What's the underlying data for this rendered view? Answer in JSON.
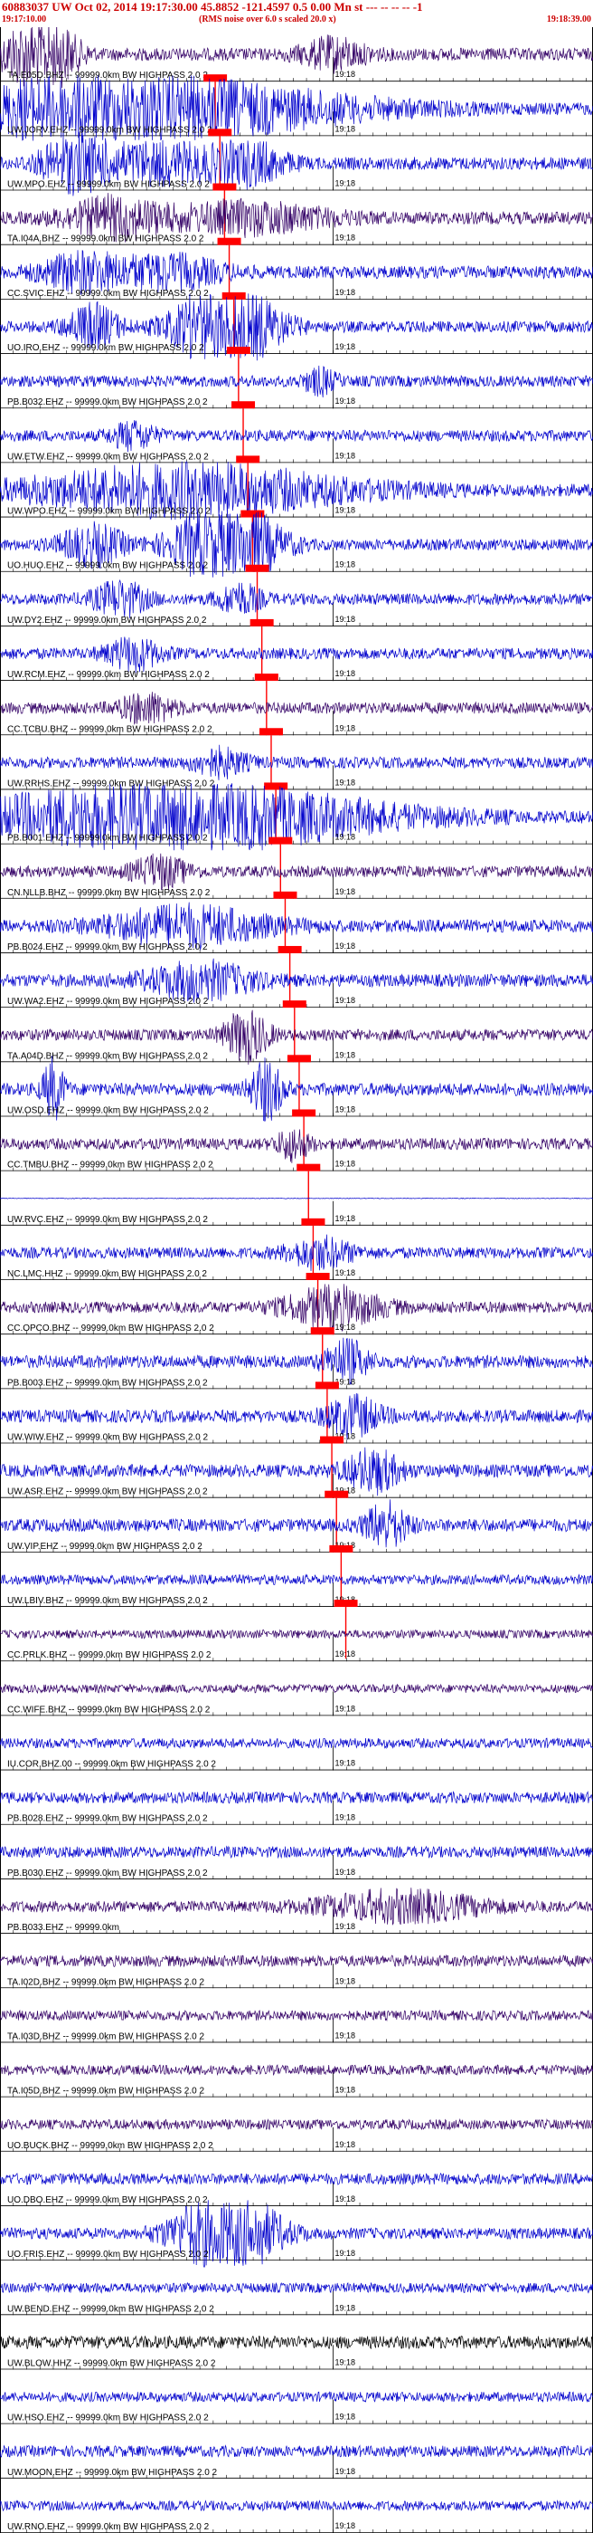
{
  "header": {
    "title": "60883037 UW Oct 02, 2014 19:17:30.00   45.8852 -121.4597  0.5 0.00 Mn st --- -- -- --  -1",
    "start_time": "19:17:10.00",
    "note": "(RMS noise over 6.0 s scaled 20.0 x)",
    "end_time": "19:18:39.00"
  },
  "chart_data": {
    "type": "seismogram",
    "tick_label": "19:18",
    "time_axis": {
      "start": "19:17:10.00",
      "end": "19:18:39.00",
      "origin": "19:17:30.00"
    },
    "colors": {
      "trace_blue": "#0000cc",
      "trace_purple": "#330066",
      "trace_black": "#000000",
      "pick": "#ff0000",
      "title": "#cc0000"
    },
    "traces": [
      {
        "label": "TA.E05D.BHZ -- 99999.0km BW  HIGHPASS  2.0  2",
        "pick_s": 32.3,
        "color": "purple",
        "amp": 0.9,
        "events": [
          [
            6,
            12,
            3.5
          ],
          [
            50,
            12,
            1.0
          ]
        ]
      },
      {
        "label": "UW.JORV.EHZ -- 99999.0km BW  HIGHPASS  2.0  2",
        "pick_s": 33.0,
        "color": "blue",
        "amp": 0.9,
        "events": [
          [
            9,
            22,
            1.2
          ],
          [
            24,
            70,
            2.0
          ]
        ]
      },
      {
        "label": "UW.MPO.EHZ -- 99999.0km BW  HIGHPASS  2.0  2",
        "pick_s": 33.7,
        "color": "blue",
        "amp": 0.9,
        "events": [
          [
            11,
            12,
            1.5
          ],
          [
            24,
            30,
            1.3
          ],
          [
            38,
            12,
            1.1
          ]
        ]
      },
      {
        "label": "TA.I04A.BHZ -- 99999.0km BW  HIGHPASS  2.0  2",
        "pick_s": 34.4,
        "color": "purple",
        "amp": 0.9,
        "events": [
          [
            17,
            18,
            1.3
          ],
          [
            37,
            30,
            1.0
          ]
        ]
      },
      {
        "label": "CC.SVIC.EHZ -- 99999.0km BW  HIGHPASS  2.0  2",
        "pick_s": 35.1,
        "color": "blue",
        "amp": 0.9,
        "events": [
          [
            12,
            15,
            1.2
          ],
          [
            25,
            20,
            1.1
          ]
        ]
      },
      {
        "label": "UO.IRO.EHZ -- 99999.0km BW  HIGHPASS  2.0  2",
        "pick_s": 35.8,
        "color": "blue",
        "amp": 0.8,
        "events": [
          [
            14,
            10,
            1.6
          ],
          [
            34,
            18,
            4.0
          ]
        ]
      },
      {
        "label": "PB.B032.EHZ -- 99999.0km BW  HIGHPASS  2.0  2",
        "pick_s": 36.5,
        "color": "blue",
        "amp": 0.8,
        "events": [
          [
            48,
            6,
            0.9
          ]
        ]
      },
      {
        "label": "UW.ETW.EHZ -- 99999.0km BW  HIGHPASS  2.0  2",
        "pick_s": 37.2,
        "color": "blue",
        "amp": 0.8,
        "events": [
          [
            20,
            8,
            1.0
          ]
        ]
      },
      {
        "label": "UW.WPO.EHZ -- 99999.0km BW  HIGHPASS  2.0  2",
        "pick_s": 37.9,
        "color": "blue",
        "amp": 0.9,
        "events": [
          [
            28,
            60,
            1.7
          ]
        ]
      },
      {
        "label": "UO.HUO.EHZ -- 99999.0km BW  HIGHPASS  2.0  2",
        "pick_s": 38.6,
        "color": "blue",
        "amp": 0.8,
        "events": [
          [
            14,
            12,
            1.5
          ],
          [
            34,
            18,
            4.0
          ]
        ]
      },
      {
        "label": "UW.DY2.EHZ -- 99999.0km BW  HIGHPASS  2.0  2",
        "pick_s": 39.3,
        "color": "blue",
        "amp": 0.8,
        "events": [
          [
            18,
            10,
            1.3
          ],
          [
            36,
            8,
            1.1
          ]
        ]
      },
      {
        "label": "UW.RCM.EHZ -- 99999.0km BW  HIGHPASS  2.0  2",
        "pick_s": 40.0,
        "color": "blue",
        "amp": 0.8,
        "events": [
          [
            20,
            10,
            1.2
          ]
        ]
      },
      {
        "label": "CC.TCBU.BHZ -- 99999.0km BW  HIGHPASS  2.0  2",
        "pick_s": 40.7,
        "color": "purple",
        "amp": 0.8,
        "events": [
          [
            22,
            10,
            1.1
          ]
        ]
      },
      {
        "label": "UW.RRHS.EHZ -- 99999.0km BW  HIGHPASS  2.0  2",
        "pick_s": 41.4,
        "color": "blue",
        "amp": 0.8,
        "events": [
          [
            33,
            10,
            1.0
          ]
        ]
      },
      {
        "label": "PB.B001.EHZ -- 99999.0km BW  HIGHPASS  2.0  2",
        "pick_s": 42.1,
        "color": "blue",
        "amp": 0.9,
        "events": [
          [
            26,
            74,
            2.4
          ]
        ]
      },
      {
        "label": "CN.NLLB.BHZ -- 99999.0km BW  HIGHPASS  2.0  2",
        "pick_s": 42.8,
        "color": "purple",
        "amp": 0.8,
        "events": [
          [
            24,
            10,
            1.2
          ]
        ]
      },
      {
        "label": "PB.B024.EHZ -- 99999.0km BW  HIGHPASS  2.0  2",
        "pick_s": 43.5,
        "color": "blue",
        "amp": 0.9,
        "events": [
          [
            28,
            30,
            1.3
          ]
        ]
      },
      {
        "label": "UW.WA2.EHZ -- 99999.0km BW  HIGHPASS  2.0  2",
        "pick_s": 44.2,
        "color": "blue",
        "amp": 0.9,
        "events": [
          [
            30,
            20,
            1.2
          ]
        ]
      },
      {
        "label": "TA.A04D.BHZ -- 99999.0km BW  HIGHPASS  2.0  2",
        "pick_s": 44.9,
        "color": "purple",
        "amp": 0.8,
        "events": [
          [
            37,
            8,
            2.0
          ]
        ]
      },
      {
        "label": "UW.OSD.EHZ -- 99999.0km BW  HIGHPASS  2.0  2",
        "pick_s": 45.6,
        "color": "blue",
        "amp": 0.9,
        "events": [
          [
            8,
            4,
            2.0
          ],
          [
            40,
            6,
            2.0
          ]
        ]
      },
      {
        "label": "CC.TMBU.BHZ -- 99999.0km BW  HIGHPASS  2.0  2",
        "pick_s": 46.3,
        "color": "purple",
        "amp": 0.8,
        "events": [
          [
            44,
            6,
            1.2
          ]
        ]
      },
      {
        "label": "UW.RVC.EHZ -- 99999.0km BW  HIGHPASS  2.0  2",
        "pick_s": 47.0,
        "color": "blue",
        "amp": 0.05,
        "events": []
      },
      {
        "label": "NC.LMC.HHZ -- 99999.0km BW  HIGHPASS  2.0  2",
        "pick_s": 47.7,
        "color": "blue",
        "amp": 0.8,
        "events": [
          [
            48,
            12,
            1.1
          ]
        ]
      },
      {
        "label": "CC.OPCO.BHZ -- 99999.0km BW  HIGHPASS  2.0  2",
        "pick_s": 48.4,
        "color": "purple",
        "amp": 0.8,
        "events": [
          [
            50,
            18,
            1.5
          ]
        ]
      },
      {
        "label": "PB.B003.EHZ -- 99999.0km BW  HIGHPASS  2.0  2",
        "pick_s": 49.1,
        "color": "blue",
        "amp": 0.9,
        "events": [
          [
            52,
            8,
            1.4
          ]
        ]
      },
      {
        "label": "UW.WIW.EHZ -- 99999.0km BW  HIGHPASS  2.0  2",
        "pick_s": 49.8,
        "color": "blue",
        "amp": 0.9,
        "events": [
          [
            53,
            10,
            1.3
          ]
        ]
      },
      {
        "label": "UW.ASR.EHZ -- 99999.0km BW  HIGHPASS  2.0  2",
        "pick_s": 50.5,
        "color": "blue",
        "amp": 0.9,
        "events": [
          [
            56,
            10,
            1.4
          ]
        ]
      },
      {
        "label": "UW.VIP.EHZ -- 99999.0km BW  HIGHPASS  2.0  2",
        "pick_s": 51.2,
        "color": "blue",
        "amp": 0.9,
        "events": [
          [
            58,
            8,
            1.5
          ]
        ]
      },
      {
        "label": "UW.LBIV.BHZ -- 99999.0km BW  HIGHPASS  2.0  2",
        "pick_s": 51.9,
        "color": "blue",
        "amp": 0.7,
        "events": []
      },
      {
        "label": "CC.PRLK.BHZ -- 99999.0km BW  HIGHPASS  2.0  2",
        "pick_s": null,
        "color": "purple",
        "amp": 0.6,
        "events": []
      },
      {
        "label": "CC.WIFE.BHZ -- 99999.0km BW  HIGHPASS  2.0  2",
        "pick_s": null,
        "color": "purple",
        "amp": 0.6,
        "events": []
      },
      {
        "label": "IU.COR.BHZ.00 -- 99999.0km BW  HIGHPASS  2.0  2",
        "pick_s": null,
        "color": "blue",
        "amp": 0.7,
        "events": []
      },
      {
        "label": "PB.B028.EHZ -- 99999.0km BW  HIGHPASS  2.0  2",
        "pick_s": null,
        "color": "blue",
        "amp": 0.8,
        "events": []
      },
      {
        "label": "PB.B030.EHZ -- 99999.0km BW  HIGHPASS  2.0  2",
        "pick_s": null,
        "color": "blue",
        "amp": 0.8,
        "events": []
      },
      {
        "label": "PB.B033.EHZ -- 99999.0km",
        "pick_s": null,
        "color": "purple",
        "amp": 0.8,
        "events": [
          [
            60,
            30,
            1.1
          ]
        ]
      },
      {
        "label": "TA.I02D.BHZ -- 99999.0km BW  HIGHPASS  2.0  2",
        "pick_s": null,
        "color": "purple",
        "amp": 0.8,
        "events": []
      },
      {
        "label": "TA.I03D.BHZ -- 99999.0km BW  HIGHPASS  2.0  2",
        "pick_s": null,
        "color": "purple",
        "amp": 0.7,
        "events": []
      },
      {
        "label": "TA.I05D.BHZ -- 99999.0km BW  HIGHPASS  2.0  2",
        "pick_s": null,
        "color": "purple",
        "amp": 0.7,
        "events": []
      },
      {
        "label": "UO.BUCK.BHZ -- 99999.0km BW  HIGHPASS  2.0  2",
        "pick_s": null,
        "color": "purple",
        "amp": 0.7,
        "events": []
      },
      {
        "label": "UO.DBO.EHZ -- 99999.0km BW  HIGHPASS  2.0  2",
        "pick_s": null,
        "color": "blue",
        "amp": 0.8,
        "events": []
      },
      {
        "label": "UO.FRIS.EHZ -- 99999.0km BW  HIGHPASS  2.0  2",
        "pick_s": null,
        "color": "blue",
        "amp": 0.8,
        "events": [
          [
            34,
            18,
            4.0
          ]
        ]
      },
      {
        "label": "UW.BEND.EHZ -- 99999.0km BW  HIGHPASS  2.0  2",
        "pick_s": null,
        "color": "blue",
        "amp": 0.7,
        "events": []
      },
      {
        "label": "UW.BLOW.HHZ -- 99999.0km BW  HIGHPASS  2.0  2",
        "pick_s": null,
        "color": "black",
        "amp": 0.9,
        "events": []
      },
      {
        "label": "UW.HSO.EHZ -- 99999.0km BW  HIGHPASS  2.0  2",
        "pick_s": null,
        "color": "blue",
        "amp": 0.7,
        "events": []
      },
      {
        "label": "UW.MOON.EHZ -- 99999.0km BW  HIGHPASS  2.0  2",
        "pick_s": null,
        "color": "blue",
        "amp": 0.8,
        "events": []
      },
      {
        "label": "UW.RNO.EHZ -- 99999.0km BW  HIGHPASS  2.0  2",
        "pick_s": null,
        "color": "blue",
        "amp": 0.7,
        "events": []
      }
    ]
  }
}
